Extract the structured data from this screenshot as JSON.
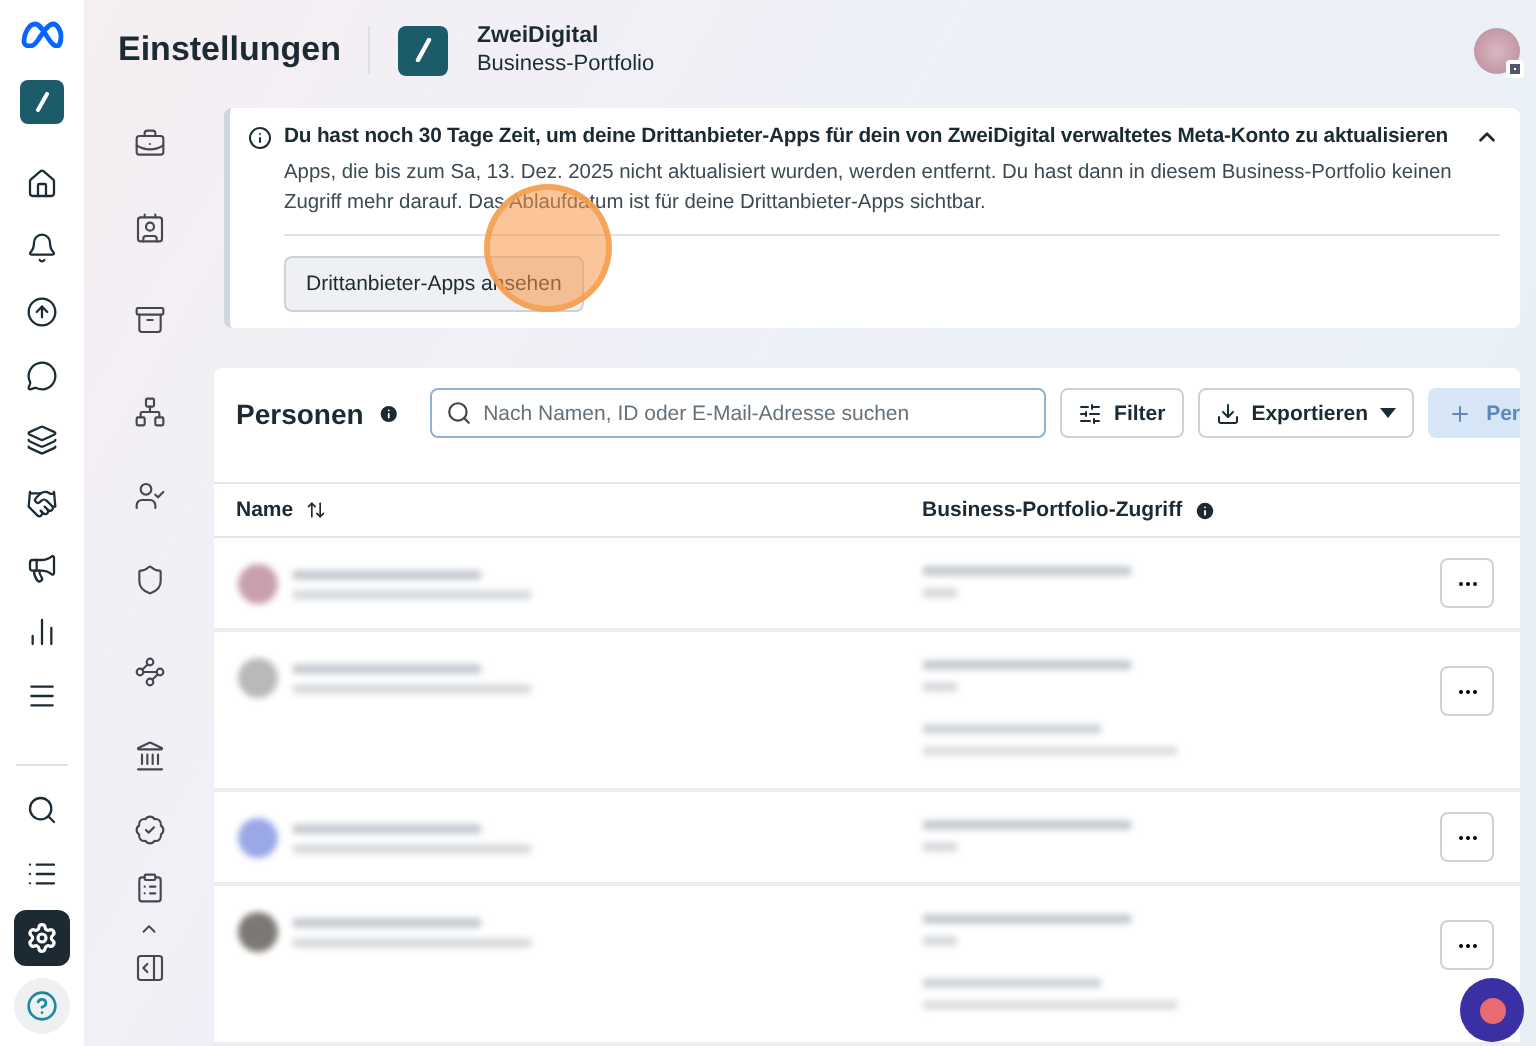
{
  "header": {
    "title": "Einstellungen",
    "portfolio_name": "ZweiDigital",
    "portfolio_type": "Business-Portfolio"
  },
  "rail": {
    "items": [
      {
        "selected": false
      },
      {
        "selected": false
      },
      {
        "selected": false
      },
      {
        "selected": false
      },
      {
        "selected": false
      },
      {
        "selected": false
      },
      {
        "selected": false
      },
      {
        "selected": false
      },
      {
        "selected": false
      }
    ],
    "bottom_items": [
      {
        "selected": false
      },
      {
        "selected": false
      },
      {
        "selected": true
      },
      {
        "selected": false
      }
    ]
  },
  "banner": {
    "title": "Du hast noch 30 Tage Zeit, um deine Drittanbieter-Apps für dein von ZweiDigital verwaltetes Meta-Konto zu aktualisieren",
    "expanded": true,
    "body": "Apps, die bis zum Sa, 13. Dez. 2025 nicht aktualisiert wurden, werden entfernt. Du hast dann in diesem Business-Portfolio keinen Zugriff mehr darauf. Das Ablaufdatum ist für deine Drittanbieter-Apps sichtbar.",
    "button": "Drittanbieter-Apps ansehen"
  },
  "people": {
    "title": "Personen",
    "search": {
      "placeholder": "Nach Namen, ID oder E-Mail-Adresse suchen"
    },
    "filter_button": "Filter",
    "export_button": "Exportieren",
    "add_button": {
      "label": "Per",
      "disabled": true
    },
    "columns": [
      "Name",
      "Business-Portfolio-Zugriff"
    ],
    "rows": [
      {
        "color": "#c9a0ad",
        "kind": "single"
      },
      {
        "color": "#b9b9b9",
        "kind": "double"
      },
      {
        "color": "#9aa8e8",
        "kind": "single"
      },
      {
        "color": "#7d7873",
        "kind": "double"
      }
    ]
  }
}
